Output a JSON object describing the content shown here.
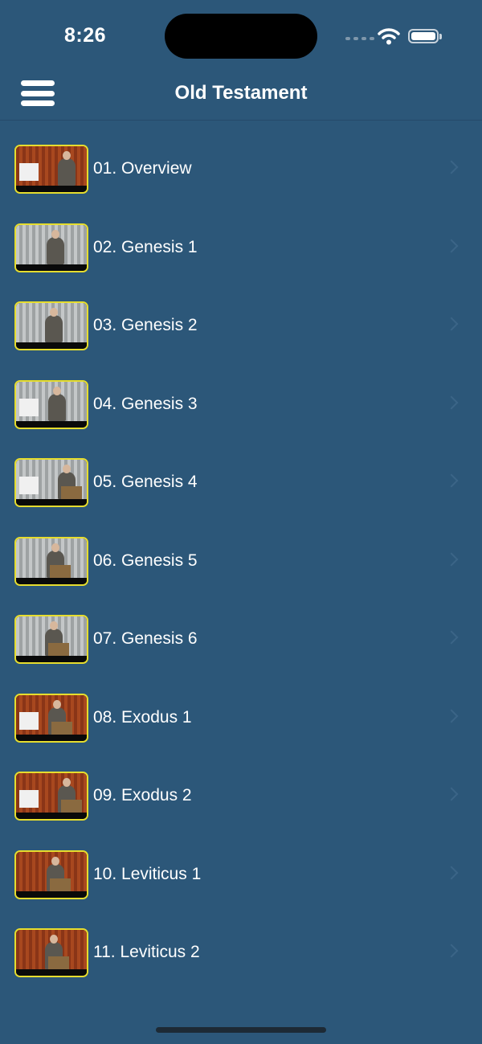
{
  "status_bar": {
    "time": "8:26"
  },
  "nav": {
    "title": "Old Testament"
  },
  "lessons": [
    {
      "label": "01. Overview",
      "backdrop": "red"
    },
    {
      "label": "02. Genesis 1",
      "backdrop": "grey"
    },
    {
      "label": "03. Genesis 2",
      "backdrop": "grey"
    },
    {
      "label": "04. Genesis 3",
      "backdrop": "grey"
    },
    {
      "label": "05. Genesis 4",
      "backdrop": "grey"
    },
    {
      "label": "06. Genesis 5",
      "backdrop": "grey"
    },
    {
      "label": "07. Genesis 6",
      "backdrop": "grey"
    },
    {
      "label": "08. Exodus 1",
      "backdrop": "red"
    },
    {
      "label": "09. Exodus 2",
      "backdrop": "red"
    },
    {
      "label": "10. Leviticus 1",
      "backdrop": "red"
    },
    {
      "label": "11. Leviticus 2",
      "backdrop": "red"
    }
  ],
  "colors": {
    "background": "#2c5779",
    "thumbnail_border": "#e6dd2e",
    "text": "#ffffff"
  },
  "icons": {
    "menu": "hamburger-menu-icon",
    "row_accessory": "chevron-right-icon",
    "thumbnail": "video-thumbnail"
  }
}
